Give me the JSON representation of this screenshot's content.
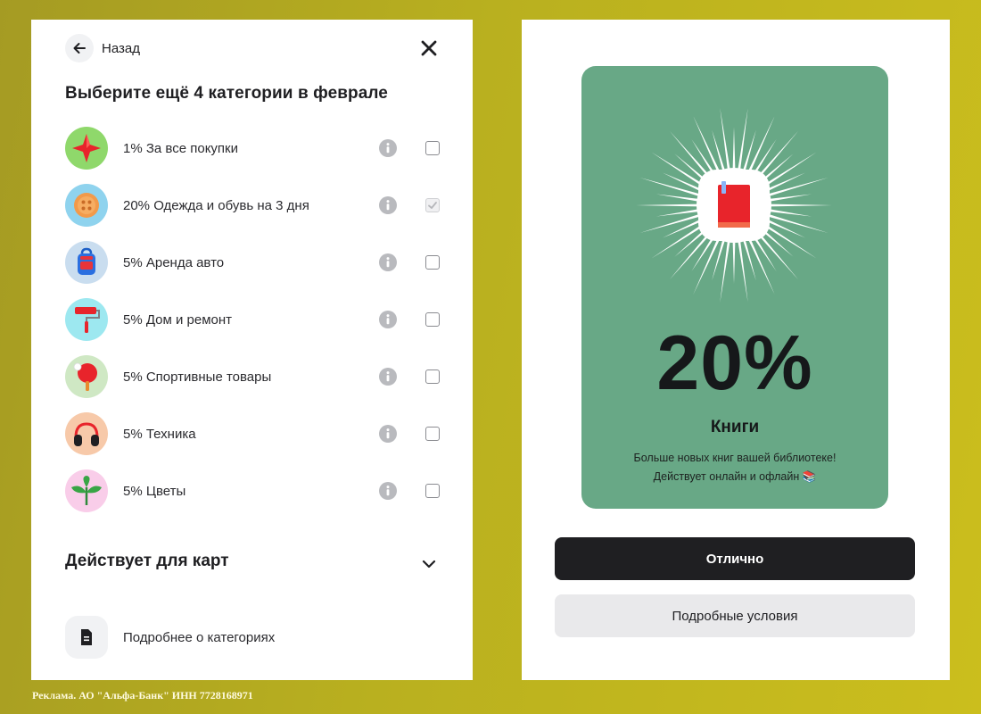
{
  "left_panel": {
    "back_label": "Назад",
    "title": "Выберите ещё 4 категории в феврале",
    "categories": [
      {
        "label": "1% За все покупки",
        "icon": "red-star-icon",
        "bg": "#8fd86b",
        "checked": false
      },
      {
        "label": "20% Одежда и обувь на 3 дня",
        "icon": "button-icon",
        "bg": "#8fd3ee",
        "checked": true
      },
      {
        "label": "5% Аренда авто",
        "icon": "backpack-icon",
        "bg": "#c9ddef",
        "checked": false
      },
      {
        "label": "5% Дом и ремонт",
        "icon": "paint-roller-icon",
        "bg": "#9de8f0",
        "checked": false
      },
      {
        "label": "5% Спортивные товары",
        "icon": "ping-pong-icon",
        "bg": "#cfe8c4",
        "checked": false
      },
      {
        "label": "5% Техника",
        "icon": "headphones-icon",
        "bg": "#f7c9a9",
        "checked": false
      },
      {
        "label": "5% Цветы",
        "icon": "leaf-sprout-icon",
        "bg": "#f9cde9",
        "checked": false
      }
    ],
    "cards_title": "Действует для карт",
    "more_label": "Подробнее о категориях"
  },
  "right_panel": {
    "promo": {
      "percent": "20%",
      "category": "Книги",
      "desc_line1": "Больше новых книг вашей библиотеке!",
      "desc_line2": "Действует онлайн и офлайн 📚",
      "card_color": "#68a886"
    },
    "primary_button": "Отлично",
    "secondary_button": "Подробные условия"
  },
  "footer": {
    "ad_text": "Реклама. АО \"Альфа-Банк\" ИНН 7728168971"
  }
}
